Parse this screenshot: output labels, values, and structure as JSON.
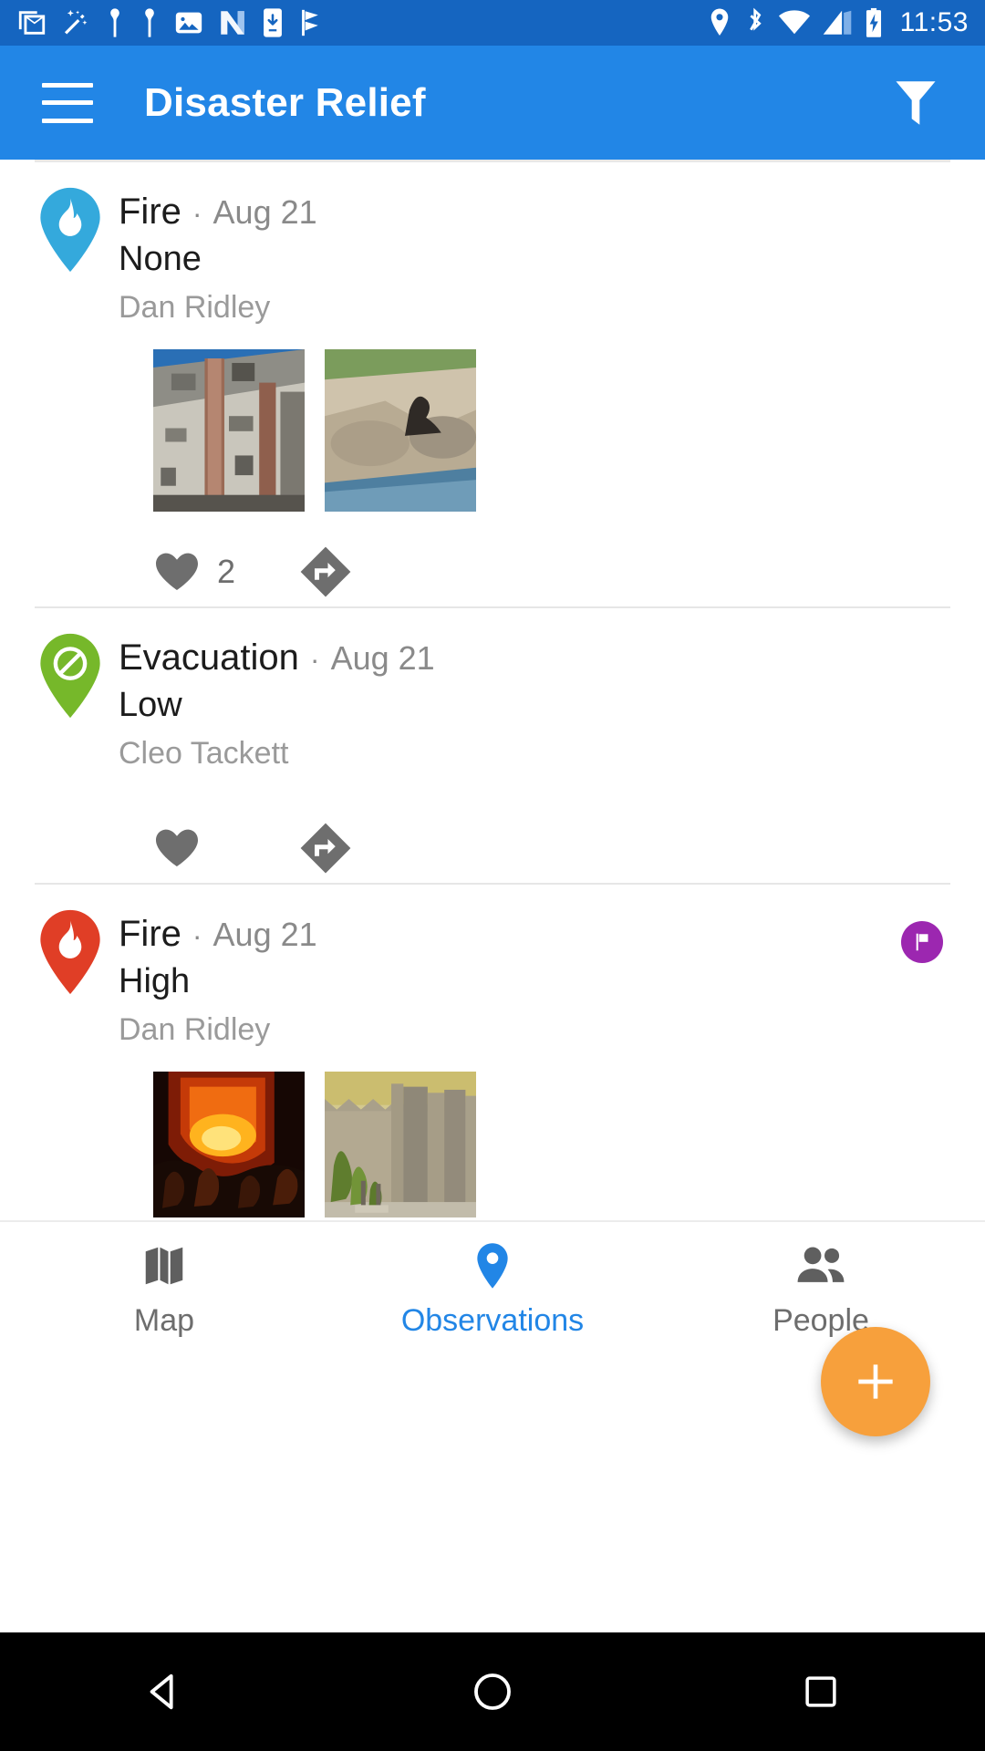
{
  "status_bar": {
    "time": "11:53",
    "left_icons": [
      "gmail-icon",
      "magic-wand-icon",
      "pin-person-icon",
      "pin-person-icon",
      "photos-icon",
      "nova-n-icon",
      "download-phone-icon",
      "checkmark-flag-icon"
    ],
    "right_icons": [
      "location-icon",
      "bluetooth-icon",
      "wifi-icon",
      "cellular-signal-icon",
      "battery-charging-icon"
    ],
    "background_color": "#1565C0"
  },
  "app_bar": {
    "menu_label": "menu",
    "title": "Disaster Relief",
    "filter_label": "filter",
    "background_color": "#2286E6"
  },
  "observations": [
    {
      "type": "Fire",
      "separator": "·",
      "date": "Aug 21",
      "severity": "None",
      "user": "Dan Ridley",
      "pin_color": "#34A9DC",
      "pin_icon": "flame-icon",
      "flagged": false,
      "like_count": "2",
      "photos": [
        "building-facade-photo",
        "seal-on-rocks-photo"
      ]
    },
    {
      "type": "Evacuation",
      "separator": "·",
      "date": "Aug 21",
      "severity": "Low",
      "user": "Cleo Tackett",
      "pin_color": "#76B82A",
      "pin_icon": "no-entry-icon",
      "flagged": false,
      "like_count": "",
      "photos": []
    },
    {
      "type": "Fire",
      "separator": "·",
      "date": "Aug 21",
      "severity": "High",
      "user": "Dan Ridley",
      "pin_color": "#E03E26",
      "pin_icon": "flame-icon",
      "flagged": true,
      "flag_color": "#9C27B0",
      "like_count": "",
      "photos": [
        "firefighters-blaze-photo",
        "elephant-enclosure-photo"
      ]
    }
  ],
  "fab": {
    "label": "+",
    "color": "#F7A03C",
    "name": "add-observation"
  },
  "bottom_nav": {
    "active_color": "#2286E6",
    "inactive_color": "#6d6d6d",
    "tabs": [
      {
        "label": "Map",
        "icon": "map-icon",
        "active": false
      },
      {
        "label": "Observations",
        "icon": "location-pin-icon",
        "active": true
      },
      {
        "label": "People",
        "icon": "people-icon",
        "active": false
      }
    ]
  },
  "android_nav": {
    "buttons": [
      {
        "name": "back-button",
        "icon": "triangle-back-icon"
      },
      {
        "name": "home-button",
        "icon": "circle-home-icon"
      },
      {
        "name": "recents-button",
        "icon": "square-recents-icon"
      }
    ]
  }
}
